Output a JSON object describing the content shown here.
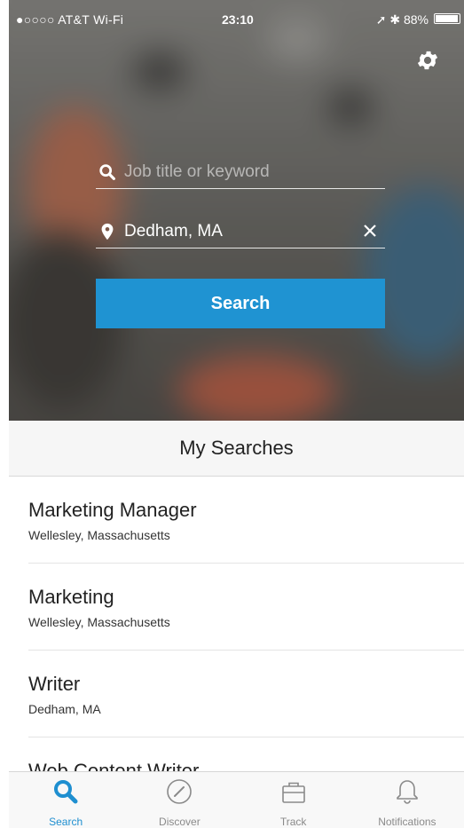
{
  "status_bar": {
    "carrier": "●○○○○ AT&T Wi-Fi",
    "time": "23:10",
    "battery": "88%"
  },
  "hero": {
    "keyword_placeholder": "Job title or keyword",
    "location_value": "Dedham, MA",
    "search_label": "Search",
    "button_color": "#1f93d2"
  },
  "my_searches": {
    "header": "My Searches",
    "items": [
      {
        "title": "Marketing Manager",
        "location": "Wellesley, Massachusetts"
      },
      {
        "title": "Marketing",
        "location": "Wellesley, Massachusetts"
      },
      {
        "title": "Writer",
        "location": "Dedham, MA"
      },
      {
        "title": "Web Content Writer",
        "location": ""
      }
    ]
  },
  "tabbar": {
    "tabs": [
      {
        "label": "Search",
        "icon": "search-icon",
        "active": true
      },
      {
        "label": "Discover",
        "icon": "compass-icon",
        "active": false
      },
      {
        "label": "Track",
        "icon": "briefcase-icon",
        "active": false
      },
      {
        "label": "Notifications",
        "icon": "bell-icon",
        "active": false
      }
    ],
    "active_color": "#1f8fd0"
  }
}
